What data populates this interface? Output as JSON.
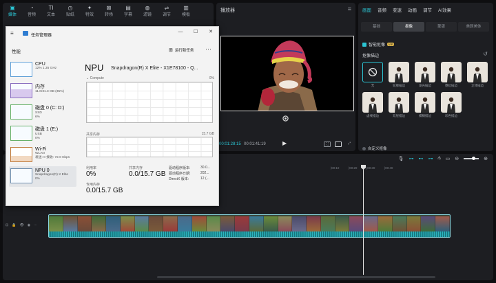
{
  "media_toolbar": [
    {
      "label": "媒体",
      "icon": "media-icon",
      "glyph": "▣",
      "active": true
    },
    {
      "label": "音频",
      "icon": "audio-icon",
      "glyph": "◔"
    },
    {
      "label": "文本",
      "icon": "text-icon",
      "glyph": "TI"
    },
    {
      "label": "贴纸",
      "icon": "sticker-icon",
      "glyph": "◷"
    },
    {
      "label": "特效",
      "icon": "effects-icon",
      "glyph": "✦"
    },
    {
      "label": "转场",
      "icon": "transition-icon",
      "glyph": "⊠"
    },
    {
      "label": "字幕",
      "icon": "caption-icon",
      "glyph": "▤"
    },
    {
      "label": "滤镜",
      "icon": "filter-icon",
      "glyph": "◍"
    },
    {
      "label": "调节",
      "icon": "adjust-icon",
      "glyph": "⇌"
    },
    {
      "label": "模板",
      "icon": "template-icon",
      "glyph": "▥"
    }
  ],
  "player": {
    "title": "播放器",
    "current_time": "00:01:28:15",
    "total_time": "00:01:41:19",
    "play": "▶",
    "menu": "≡"
  },
  "inspector": {
    "tabs": [
      "画面",
      "音频",
      "变速",
      "动画",
      "调节",
      "AI效果"
    ],
    "subtabs": [
      "基础",
      "抠像",
      "蒙版",
      "美颜美体"
    ],
    "smart_matting": "智能抠像",
    "pro_badge": "VIP",
    "section_title": "抠像描边",
    "custom": "自定义抠像",
    "background_presets": [
      {
        "label": "无",
        "none": true
      },
      {
        "label": "轮廓描边"
      },
      {
        "label": "发光描边"
      },
      {
        "label": "霓虹描边"
      },
      {
        "label": "立体描边"
      },
      {
        "label": "虚线描边"
      },
      {
        "label": "双层描边"
      },
      {
        "label": "模糊描边"
      },
      {
        "label": "彩色描边"
      }
    ]
  },
  "timeline": {
    "ruler": [
      "00:00",
      "|00:10",
      "|00:20",
      "|00:30",
      "|00:40"
    ],
    "track_controls": [
      "⊡",
      "🔒",
      "👁",
      "◉",
      "⋯"
    ],
    "zoom_out": "⊖",
    "zoom_in": "⊕"
  },
  "task_manager": {
    "app_title": "任务管理器",
    "page_label": "性能",
    "run_new_task": "运行新任务",
    "more": "···",
    "window_buttons": [
      "—",
      "☐",
      "✕"
    ],
    "sidebar": [
      {
        "name": "CPU",
        "sub": "12% 1.35 GHz"
      },
      {
        "name": "内存",
        "sub": "11.0/31.3 GB (35%)"
      },
      {
        "name": "磁盘 0 (C: D:)",
        "sub": "SSD",
        "sub2": "6%"
      },
      {
        "name": "磁盘 1 (E:)",
        "sub": "USB",
        "sub2": "0%"
      },
      {
        "name": "Wi-Fi",
        "sub": "WLAN",
        "sub2": "发送: 0 接收: 72.0 Kbps"
      },
      {
        "name": "NPU 0",
        "sub": "Snapdragon(R) X Elite",
        "sub2": "0%",
        "selected": true
      }
    ],
    "npu": {
      "title": "NPU",
      "model": "Snapdragon(R) X Elite - X1E78100 - Q...",
      "graph1_label": "Compute",
      "graph1_max": "0%",
      "graph2_label": "共享内存",
      "graph2_max": "15.7 GB",
      "utilization_label": "利用率",
      "utilization_value": "0%",
      "shared_mem_label": "共享内存",
      "shared_mem_value": "0.0/15.7 GB",
      "dedicated_label": "专用内存",
      "dedicated_value": "0.0/15.7 GB",
      "driver_version_label": "驱动程序版本:",
      "driver_version": "30.0...",
      "driver_date_label": "驱动程序日期:",
      "driver_date": "202...",
      "directx_label": "DirectX 版本:",
      "directx": "12 (..."
    }
  },
  "colors": {
    "accent": "#2bc5d4",
    "panel": "#1d1e22",
    "background": "#0e0e10"
  }
}
